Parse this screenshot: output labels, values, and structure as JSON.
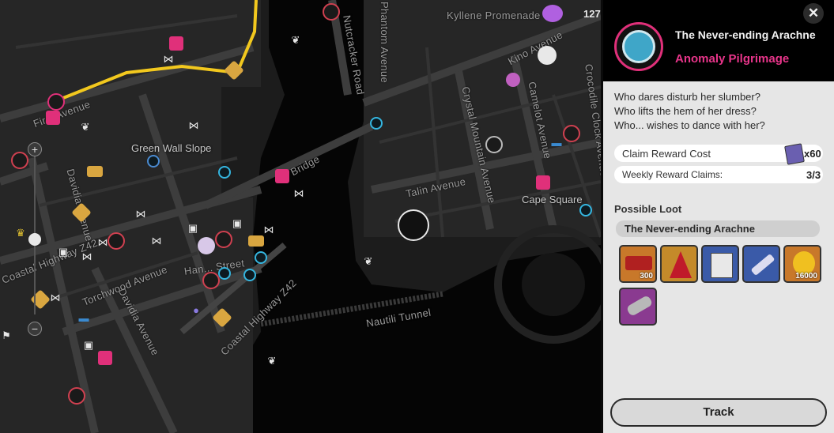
{
  "map": {
    "streets": {
      "kyllene": "Kyllene Promenade",
      "kino": "Kino Avenue",
      "phantom": "Phantom Avenue",
      "nutcracker": "Nutcracker Road",
      "camelot": "Camelot Avenue",
      "crocodile": "Crocodile Clock Avenue",
      "crystal": "Crystal Mountain Avenue",
      "talin": "Talin Avenue",
      "bridge": "Bridge",
      "first": "First Avenue",
      "davidia1": "Davidia Avenue",
      "davidia2": "Davidia Avenue",
      "torchwood": "Torchwood Avenue",
      "coastal1": "Coastal Highway Z42",
      "coastal2": "Coastal Highway Z42",
      "nautili": "Nautili Tunnel",
      "hanstreet": "Han... Street"
    },
    "districts": {
      "green_wall": "Green Wall Slope",
      "cape_square": "Cape Square"
    },
    "counter": "127",
    "zoom_in": "+",
    "zoom_out": "−"
  },
  "panel": {
    "close": "✕",
    "title": "The Never-ending Arachne",
    "subtitle": "Anomaly Pilgrimage",
    "description": [
      "Who dares disturb her slumber?",
      "Who lifts the hem of her dress?",
      "Who... wishes to dance with her?"
    ],
    "claim_cost_label": "Claim Reward Cost",
    "claim_cost_value": "x60",
    "weekly_label": "Weekly Reward Claims:",
    "weekly_value": "3/3",
    "loot_heading": "Possible Loot",
    "loot_group": "The Never-ending Arachne",
    "loot": [
      {
        "name": "bounty-ticket",
        "qty": "300"
      },
      {
        "name": "red-cape",
        "qty": ""
      },
      {
        "name": "document-stack",
        "qty": ""
      },
      {
        "name": "paint-tube",
        "qty": ""
      },
      {
        "name": "gold-coin",
        "qty": "16000"
      },
      {
        "name": "metal-spring",
        "qty": ""
      }
    ],
    "track_label": "Track"
  },
  "colors": {
    "accent_pink": "#e0307a",
    "route_yellow": "#f2c81e",
    "panel_bg": "#e6e6e6"
  }
}
